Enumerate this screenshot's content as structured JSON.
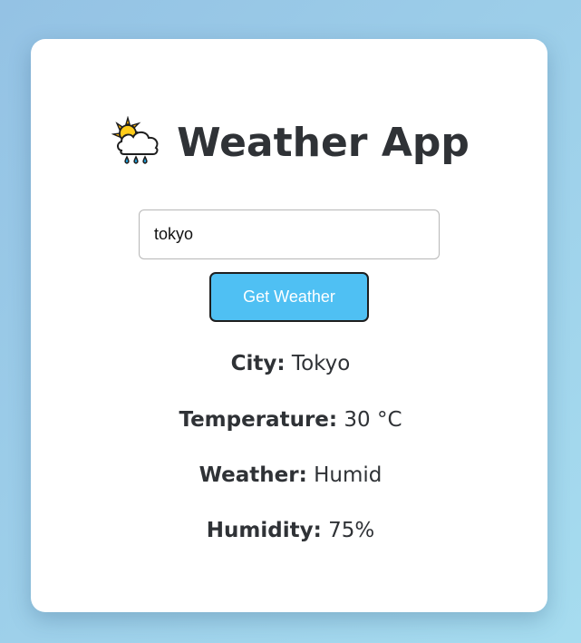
{
  "app": {
    "title": "Weather App",
    "title_icon": "cloud-sun-rain-icon"
  },
  "search": {
    "value": "tokyo",
    "button_label": "Get Weather"
  },
  "weather": {
    "city_label": "City:",
    "city_value": "Tokyo",
    "temperature_label": "Temperature:",
    "temperature_value": "30 °C",
    "condition_label": "Weather:",
    "condition_value": "Humid",
    "humidity_label": "Humidity:",
    "humidity_value": "75%"
  },
  "colors": {
    "button_bg": "#4fc0f3",
    "text": "#2f3236",
    "background_gradient_start": "#94c2e4",
    "background_gradient_end": "#a6dcef"
  }
}
